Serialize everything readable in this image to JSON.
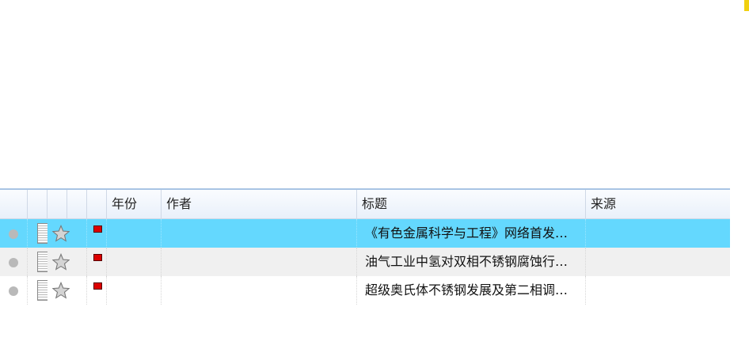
{
  "columns": {
    "year": "年份",
    "author": "作者",
    "title": "标题",
    "source": "来源"
  },
  "rows": [
    {
      "year": "",
      "author": "",
      "title": "《有色金属科学与工程》网络首发…",
      "source": "",
      "selected": true
    },
    {
      "year": "",
      "author": "",
      "title": "油气工业中氢对双相不锈钢腐蚀行…",
      "source": "",
      "selected": false
    },
    {
      "year": "",
      "author": "",
      "title": "超级奥氏体不锈钢发展及第二相调…",
      "source": "",
      "selected": false
    }
  ],
  "icons": {
    "status": "status-dot-icon",
    "document": "document-icon",
    "favorite": "star-icon",
    "flag": "red-flag-icon"
  },
  "colors": {
    "selected_row": "#64d8fe",
    "alt_row": "#f0f0f0",
    "header_border": "#a8c4e4",
    "flag": "#dd0000"
  }
}
